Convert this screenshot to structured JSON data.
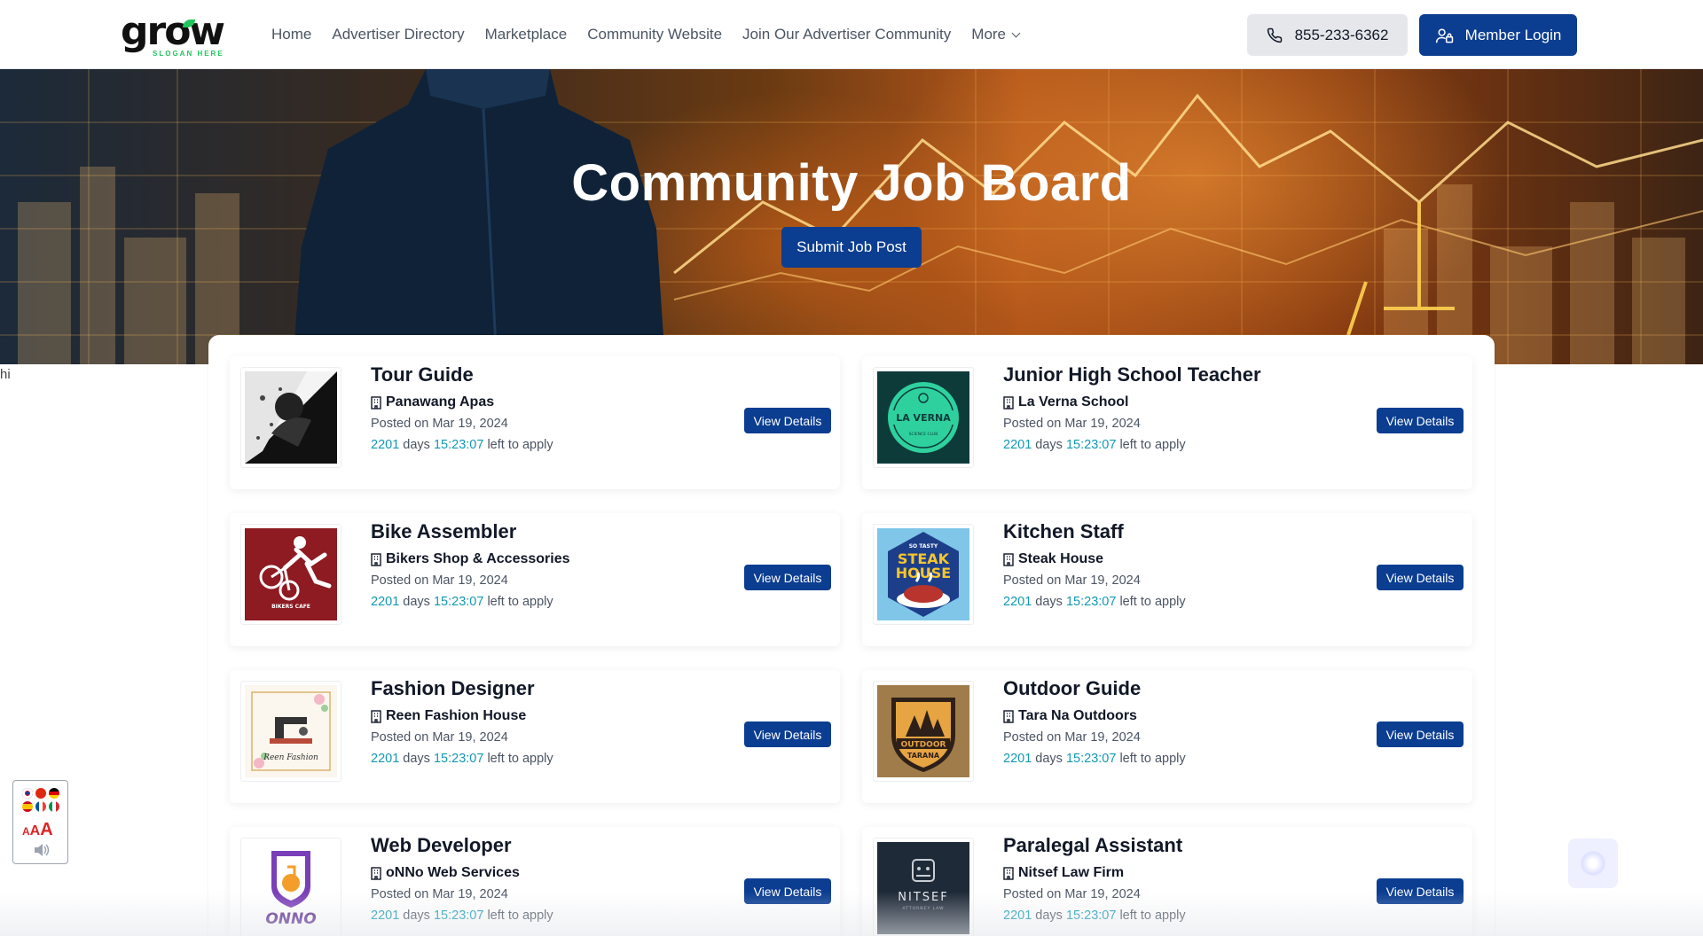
{
  "header": {
    "logo_text": "grow",
    "logo_slogan": "SLOGAN HERE",
    "nav": [
      "Home",
      "Advertiser Directory",
      "Marketplace",
      "Community Website",
      "Join Our Advertiser Community",
      "More"
    ],
    "phone": "855-233-6362",
    "login_label": "Member Login"
  },
  "hero": {
    "title": "Community Job Board",
    "submit_label": "Submit Job Post"
  },
  "stray_text": "hi",
  "jobs": [
    {
      "title": "Tour Guide",
      "company": "Panawang Apas",
      "posted": "Posted on Mar 19, 2024",
      "days": "2201",
      "days_word": "days",
      "time": "15:23:07",
      "left_text": "left to apply",
      "button": "View Details",
      "logo": "tour-guide-logo"
    },
    {
      "title": "Junior High School Teacher",
      "company": "La Verna School",
      "posted": "Posted on Mar 19, 2024",
      "days": "2201",
      "days_word": "days",
      "time": "15:23:07",
      "left_text": "left to apply",
      "button": "View Details",
      "logo": "la-verna-logo",
      "logo_text": "LA VERNA",
      "logo_subtext": "SCIENCE CLUB"
    },
    {
      "title": "Bike Assembler",
      "company": "Bikers Shop & Accessories",
      "posted": "Posted on Mar 19, 2024",
      "days": "2201",
      "days_word": "days",
      "time": "15:23:07",
      "left_text": "left to apply",
      "button": "View Details",
      "logo": "bikers-cafe-logo",
      "logo_text": "BIKERS CAFE"
    },
    {
      "title": "Kitchen Staff",
      "company": "Steak House",
      "posted": "Posted on Mar 19, 2024",
      "days": "2201",
      "days_word": "days",
      "time": "15:23:07",
      "left_text": "left to apply",
      "button": "View Details",
      "logo": "steak-house-logo",
      "logo_text": "STEAK",
      "logo_text2": "HOUSE",
      "logo_subtext": "SO TASTY"
    },
    {
      "title": "Fashion Designer",
      "company": "Reen Fashion House",
      "posted": "Posted on Mar 19, 2024",
      "days": "2201",
      "days_word": "days",
      "time": "15:23:07",
      "left_text": "left to apply",
      "button": "View Details",
      "logo": "reen-fashion-logo",
      "logo_text": "Reen Fashion"
    },
    {
      "title": "Outdoor Guide",
      "company": "Tara Na Outdoors",
      "posted": "Posted on Mar 19, 2024",
      "days": "2201",
      "days_word": "days",
      "time": "15:23:07",
      "left_text": "left to apply",
      "button": "View Details",
      "logo": "outdoor-tarana-logo",
      "logo_text": "OUTDOOR",
      "logo_text2": "TARANA"
    },
    {
      "title": "Web Developer",
      "company": "oNNo Web Services",
      "posted": "Posted on Mar 19, 2024",
      "days": "2201",
      "days_word": "days",
      "time": "15:23:07",
      "left_text": "left to apply",
      "button": "View Details",
      "logo": "onno-logo",
      "logo_text": "ONNO"
    },
    {
      "title": "Paralegal Assistant",
      "company": "Nitsef Law Firm",
      "posted": "Posted on Mar 19, 2024",
      "days": "2201",
      "days_word": "days",
      "time": "15:23:07",
      "left_text": "left to apply",
      "button": "View Details",
      "logo": "nitsef-logo",
      "logo_text": "NITSEF",
      "logo_subtext": "ATTORNEY LAW"
    }
  ],
  "colors": {
    "brand_blue": "#0b3d91",
    "teal_countdown": "#1199b4",
    "logo_green": "#22c55e"
  }
}
